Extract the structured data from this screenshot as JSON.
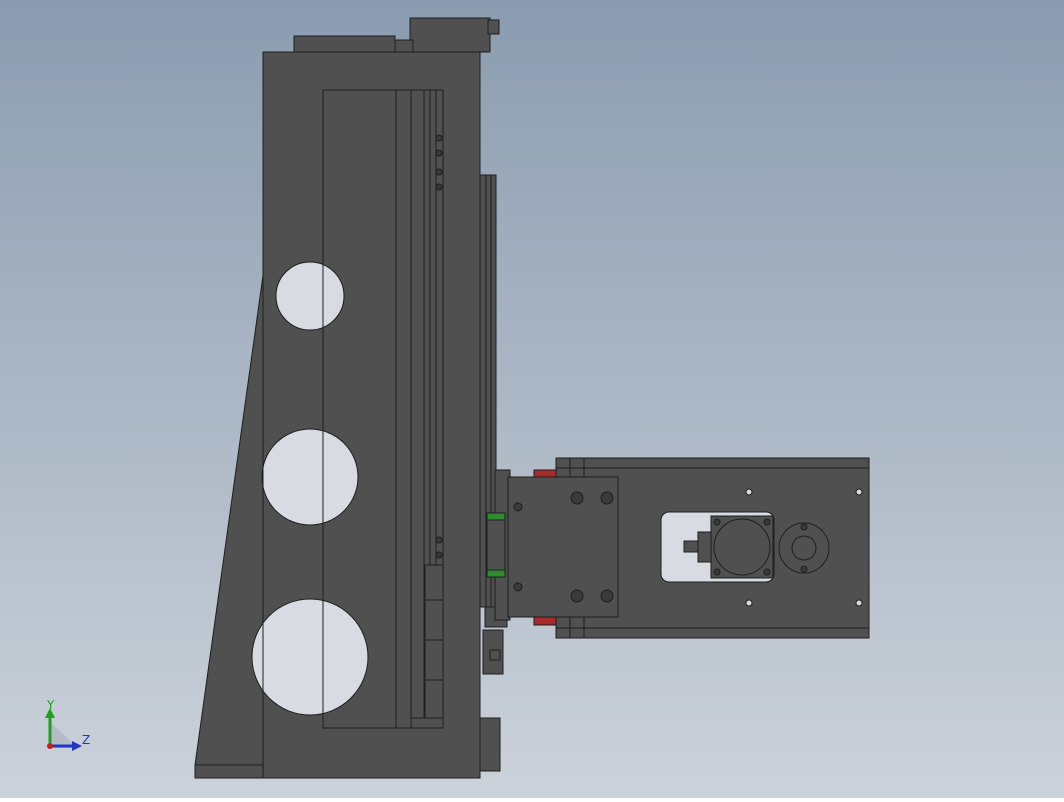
{
  "viewport": {
    "background": {
      "top": "#8b9cb0",
      "bottom": "#ccd2da"
    },
    "colors": {
      "part_fill": "#505050",
      "part_edge": "#1e1e1e",
      "hole_fill": "#d8dce2",
      "guide_accent": "#2e8b2e",
      "stop_accent": "#a82a2a"
    }
  },
  "triad": {
    "y_axis_label": "Y",
    "z_axis_label": "Z",
    "y_axis_color": "#1ea01e",
    "z_axis_color": "#2038c8",
    "origin_color": "#c81e1e"
  }
}
